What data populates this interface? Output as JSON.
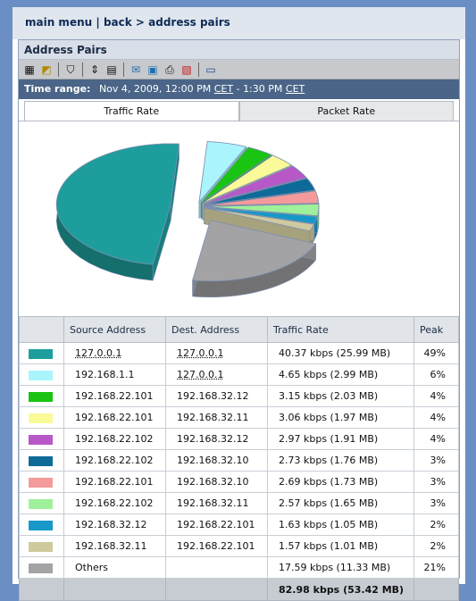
{
  "nav": {
    "main_menu": "main menu",
    "sep": "|",
    "back": "back",
    "arrow": ">",
    "current": "address pairs"
  },
  "title": "Address Pairs",
  "toolbar": {
    "icons": [
      "table-icon",
      "chart-icon",
      "filter-icon",
      "sort-icon",
      "columns-icon",
      "email-icon",
      "schedule-icon",
      "print-icon",
      "pdf-icon",
      "window-icon"
    ]
  },
  "time_range": {
    "label": "Time range:",
    "start": "Nov 4, 2009, 12:00 PM",
    "tz1": "CET",
    "dash": "-",
    "end": "1:30 PM",
    "tz2": "CET"
  },
  "tabs": [
    {
      "label": "Traffic Rate"
    },
    {
      "label": "Packet Rate"
    }
  ],
  "chart_data": {
    "type": "pie",
    "categories": [
      "127.0.0.1 > 127.0.0.1",
      "192.168.1.1 > 127.0.0.1",
      "192.168.22.101 > 192.168.32.12",
      "192.168.22.101 > 192.168.32.11",
      "192.168.22.102 > 192.168.32.12",
      "192.168.22.102 > 192.168.32.10",
      "192.168.22.101 > 192.168.32.10",
      "192.168.22.102 > 192.168.32.11",
      "192.168.32.12 > 192.168.22.101",
      "192.168.32.11 > 192.168.22.101",
      "Others"
    ],
    "values": [
      40.37,
      4.65,
      3.15,
      3.06,
      2.97,
      2.73,
      2.69,
      2.57,
      1.63,
      1.57,
      17.59
    ],
    "colors": [
      "#1d9e9c",
      "#a9f5fb",
      "#19c412",
      "#fafa99",
      "#b857c8",
      "#0e6a98",
      "#f49a9a",
      "#9ff09a",
      "#1798c8",
      "#cfca9e",
      "#a3a3a6"
    ]
  },
  "table": {
    "headers": [
      "",
      "Source Address",
      "Dest. Address",
      "Traffic Rate",
      "Peak"
    ],
    "rows": [
      {
        "color": "#1d9e9c",
        "src": "127.0.0.1",
        "dst": "127.0.0.1",
        "rate": "40.37 kbps (25.99 MB)",
        "peak": "49%"
      },
      {
        "color": "#a9f5fb",
        "src": "192.168.1.1",
        "dst": "127.0.0.1",
        "rate": "4.65 kbps (2.99 MB)",
        "peak": "6%"
      },
      {
        "color": "#19c412",
        "src": "192.168.22.101",
        "dst": "192.168.32.12",
        "rate": "3.15 kbps (2.03 MB)",
        "peak": "4%"
      },
      {
        "color": "#fafa99",
        "src": "192.168.22.101",
        "dst": "192.168.32.11",
        "rate": "3.06 kbps (1.97 MB)",
        "peak": "4%"
      },
      {
        "color": "#b857c8",
        "src": "192.168.22.102",
        "dst": "192.168.32.12",
        "rate": "2.97 kbps (1.91 MB)",
        "peak": "4%"
      },
      {
        "color": "#0e6a98",
        "src": "192.168.22.102",
        "dst": "192.168.32.10",
        "rate": "2.73 kbps (1.76 MB)",
        "peak": "3%"
      },
      {
        "color": "#f49a9a",
        "src": "192.168.22.101",
        "dst": "192.168.32.10",
        "rate": "2.69 kbps (1.73 MB)",
        "peak": "3%"
      },
      {
        "color": "#9ff09a",
        "src": "192.168.22.102",
        "dst": "192.168.32.11",
        "rate": "2.57 kbps (1.65 MB)",
        "peak": "3%"
      },
      {
        "color": "#1798c8",
        "src": "192.168.32.12",
        "dst": "192.168.22.101",
        "rate": "1.63 kbps (1.05 MB)",
        "peak": "2%"
      },
      {
        "color": "#cfca9e",
        "src": "192.168.32.11",
        "dst": "192.168.22.101",
        "rate": "1.57 kbps (1.01 MB)",
        "peak": "2%"
      },
      {
        "color": "#a3a3a6",
        "src": "Others",
        "dst": "",
        "rate": "17.59 kbps (11.33 MB)",
        "peak": "21%"
      }
    ],
    "total": "82.98 kbps (53.42 MB)"
  }
}
